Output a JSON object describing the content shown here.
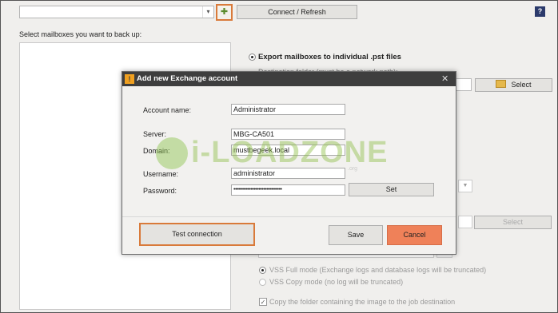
{
  "toolbar": {
    "connect_label": "Connect / Refresh",
    "help_label": "?",
    "combo_arrow": "▾"
  },
  "left": {
    "select_label": "Select mailboxes you want to back up:"
  },
  "right": {
    "export_label": "Export mailboxes to individual .pst files",
    "dest_label": "Destination folder (must be a network path):",
    "select_btn": "Select",
    "select_btn2": "Select",
    "vss_full": "VSS Full mode (Exchange logs and database logs will be truncated)",
    "vss_copy": "VSS Copy mode (no log will be truncated)",
    "copy_folder": "Copy the folder containing the image to the job destination"
  },
  "dialog": {
    "title": "Add new Exchange account",
    "close": "✕",
    "account_label": "Account name:",
    "account_value": "Administrator",
    "server_label": "Server:",
    "server_value": "MBG-CA501",
    "domain_label": "Domain:",
    "domain_value": "mustbegeek.local",
    "username_label": "Username:",
    "username_value": "administrator",
    "password_label": "Password:",
    "password_value": "•••••••••••••••••••••••••••••••",
    "set_label": "Set",
    "test_label": "Test connection",
    "save_label": "Save",
    "cancel_label": "Cancel"
  },
  "watermark": {
    "text": "i-LOADZONE",
    "sub": ".org"
  },
  "colors": {
    "accent_orange": "#ef8159",
    "highlight_border": "#d97a3a",
    "titlebar": "#3e3e3e"
  }
}
